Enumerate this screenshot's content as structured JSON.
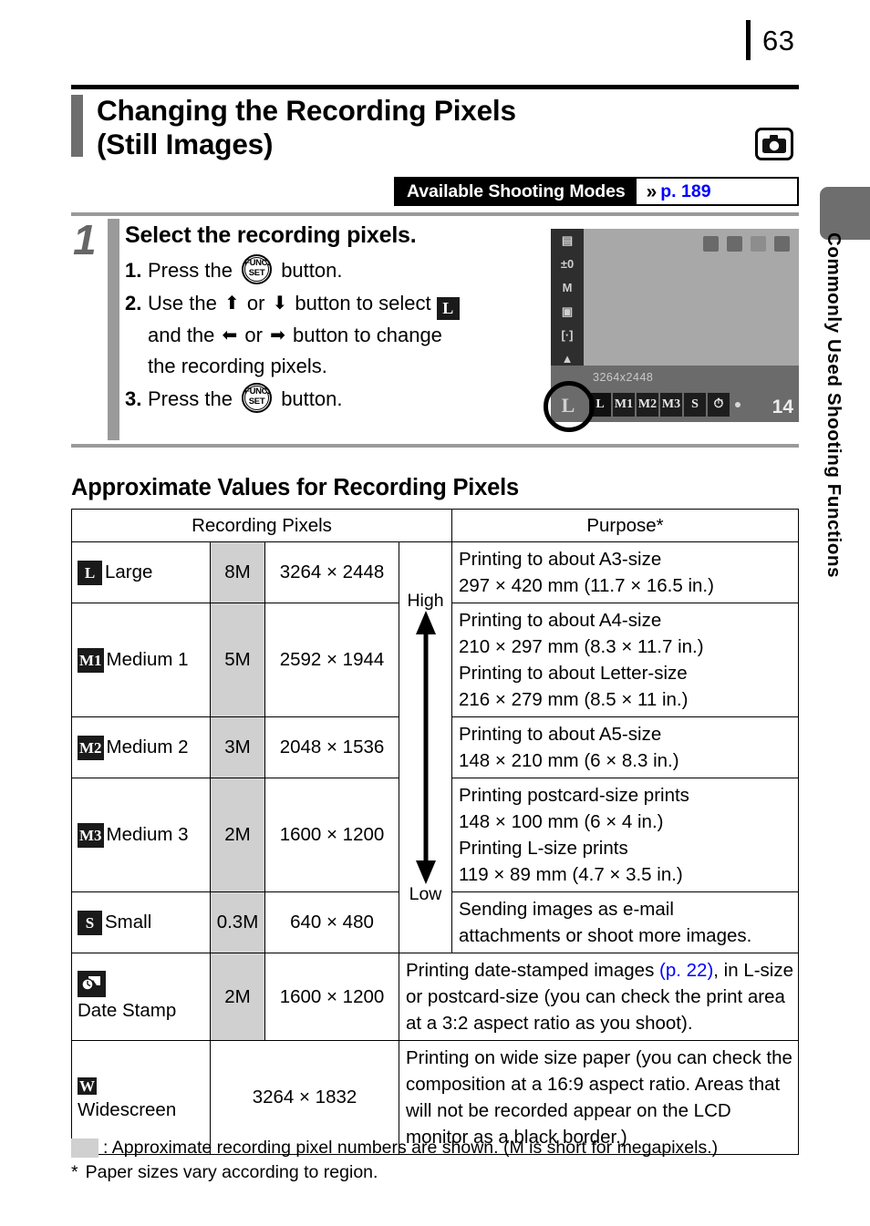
{
  "page": {
    "number": "63"
  },
  "side_tab": {
    "label": "Commonly Used Shooting Functions"
  },
  "header": {
    "title": "Changing the Recording Pixels (Still Images)",
    "camera_icon": "camera-icon",
    "modes_label": "Available Shooting Modes",
    "modes_chevron": "»",
    "modes_link": "p. 189"
  },
  "step": {
    "number": "1",
    "heading": "Select the recording pixels.",
    "items": [
      {
        "num": "1.",
        "before": "Press the",
        "icon": "func-set-button",
        "after": "button."
      },
      {
        "num": "2.",
        "before": "Use the",
        "arrow_up": "⬆",
        "mid1": "or",
        "arrow_down": "⬇",
        "mid2": "button to select",
        "badge": "L",
        "line2_before": "and the",
        "arrow_left": "⬅",
        "line2_mid": "or",
        "arrow_right": "➡",
        "line2_after": "button to change",
        "line3": "the recording pixels."
      },
      {
        "num": "3.",
        "before": "Press the",
        "icon": "func-set-button",
        "after": "button."
      }
    ],
    "func_set_icon": {
      "line1": "FUNC.",
      "line2": "SET"
    }
  },
  "lcd": {
    "left_icons": [
      "▤",
      "±0",
      "M",
      "▣",
      "[·]",
      "▲"
    ],
    "resolution_label": "3264x2448",
    "icon_row": [
      "L",
      "M1",
      "M2",
      "M3",
      "S",
      "⏱"
    ],
    "shots_remaining": "14",
    "highlight_badge": "L"
  },
  "section": {
    "title": "Approximate Values for Recording Pixels"
  },
  "table": {
    "headers": {
      "left": "Recording Pixels",
      "right": "Purpose*"
    },
    "scale": {
      "high": "High",
      "low": "Low"
    },
    "rows": [
      {
        "badge": "L",
        "name": "Large",
        "mp": "8M",
        "dim": "3264 × 2448"
      },
      {
        "badge": "M1",
        "name": "Medium 1",
        "mp": "5M",
        "dim": "2592 × 1944"
      },
      {
        "badge": "M2",
        "name": "Medium 2",
        "mp": "3M",
        "dim": "2048 × 1536"
      },
      {
        "badge": "M3",
        "name": "Medium 3",
        "mp": "2M",
        "dim": "1600 × 1200"
      },
      {
        "badge": "S",
        "name": "Small",
        "mp": "0.3M",
        "dim": "640 × 480"
      }
    ],
    "purposes": [
      {
        "lines": [
          "Printing to about A3-size",
          "297 × 420 mm (11.7 × 16.5 in.)"
        ]
      },
      {
        "lines": [
          "Printing to about A4-size",
          "210 × 297 mm (8.3 × 11.7 in.)",
          "Printing to about Letter-size",
          "216 × 279 mm (8.5 × 11 in.)"
        ]
      },
      {
        "lines": [
          "Printing to about A5-size",
          "148 × 210 mm (6 × 8.3 in.)"
        ]
      },
      {
        "lines": [
          "Printing postcard-size prints",
          "148 × 100 mm (6 × 4 in.)",
          "Printing L-size prints",
          "119 × 89 mm (4.7 × 3.5 in.)"
        ]
      },
      {
        "lines": [
          "Sending images as e-mail",
          "attachments or shoot more images."
        ]
      }
    ],
    "date_stamp": {
      "icon": "date-stamp-icon",
      "name": "Date Stamp",
      "mp": "2M",
      "dim": "1600 × 1200",
      "purpose_pre": "Printing date-stamped images ",
      "purpose_link": "(p. 22)",
      "purpose_post": ", in L-size or postcard-size (you can check the print area at a 3:2 aspect ratio as you shoot)."
    },
    "widescreen": {
      "badge": "W",
      "name": "Widescreen",
      "dim": "3264 × 1832",
      "purpose": "Printing on wide size paper (you can check the composition at a 16:9 aspect ratio. Areas that will not be recorded appear on the LCD monitor as a black border.)"
    }
  },
  "footnotes": {
    "swatch_note": ": Approximate recording pixel numbers are shown. (M is short for megapixels.)",
    "star": "*",
    "star_note": "Paper sizes vary according to region."
  }
}
